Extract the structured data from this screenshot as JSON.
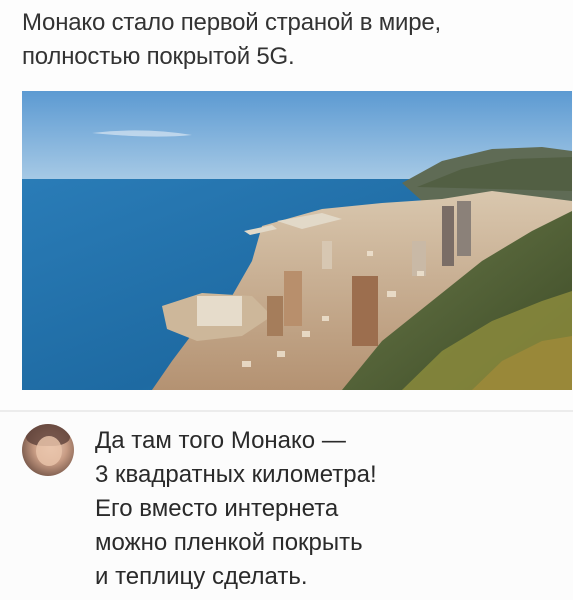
{
  "post": {
    "text_lines": [
      "Монако стало первой страной в мире,",
      "полностью покрытой 5G."
    ],
    "photo_alt": "Монако"
  },
  "comment": {
    "text_lines": [
      "Да там того Монако —",
      "3 квадратных километра!",
      "Его вместо интернета",
      "можно пленкой покрыть",
      "и теплицу сделать."
    ]
  },
  "colors": {
    "sky_top": "#6aa6d9",
    "sea": "#1f6fa6",
    "text": "#333333"
  }
}
